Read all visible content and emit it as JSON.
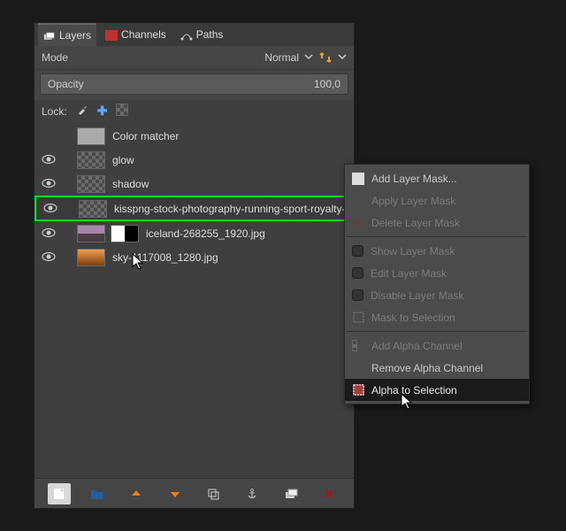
{
  "tabs": {
    "layers": "Layers",
    "channels": "Channels",
    "paths": "Paths"
  },
  "mode": {
    "label": "Mode",
    "value": "Normal"
  },
  "opacity": {
    "label": "Opacity",
    "value": "100,0"
  },
  "lock": {
    "label": "Lock:"
  },
  "layers": [
    {
      "name": "Color matcher",
      "visible": false,
      "thumb": "gray"
    },
    {
      "name": "glow",
      "visible": true,
      "thumb": "alpha-check"
    },
    {
      "name": "shadow",
      "visible": true,
      "thumb": "alpha-check"
    },
    {
      "name": "kisspng-stock-photography-running-sport-royalty-fre",
      "visible": true,
      "thumb": "alpha-check",
      "selected": true
    },
    {
      "name": "iceland-268255_1920.jpg",
      "visible": true,
      "thumb": "photo1",
      "mask": true
    },
    {
      "name": "sky-1117008_1280.jpg",
      "visible": true,
      "thumb": "photo2"
    }
  ],
  "ctx": {
    "add_mask": "Add Layer Mask...",
    "apply_mask": "Apply Layer Mask",
    "delete_mask": "Delete Layer Mask",
    "show_mask": "Show Layer Mask",
    "edit_mask": "Edit Layer Mask",
    "disable_mask": "Disable Layer Mask",
    "mask_to_sel": "Mask to Selection",
    "add_alpha": "Add Alpha Channel",
    "remove_alpha": "Remove Alpha Channel",
    "alpha_to_sel": "Alpha to Selection"
  }
}
